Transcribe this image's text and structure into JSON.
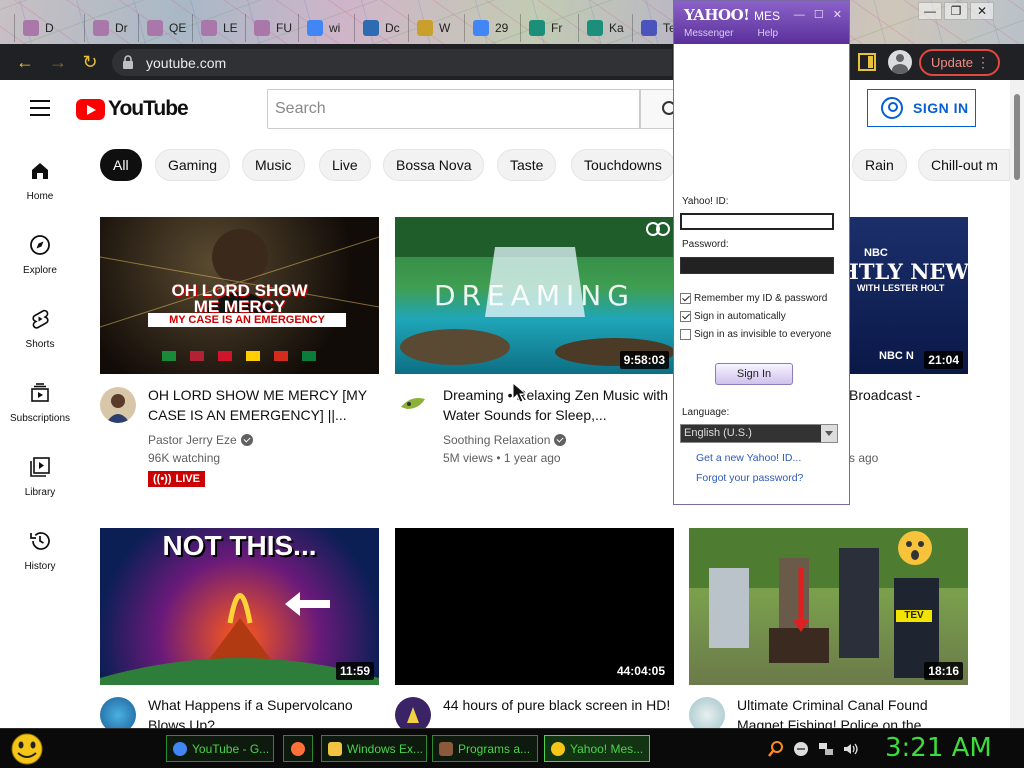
{
  "browser": {
    "tabs": [
      {
        "label": "D",
        "color": "#a7a"
      },
      {
        "label": "Dr",
        "color": "#a7a"
      },
      {
        "label": "QE",
        "color": "#a7a"
      },
      {
        "label": "LE",
        "color": "#a7a"
      },
      {
        "label": "FU",
        "color": "#a7a"
      },
      {
        "label": "wi",
        "color": "#4285f4"
      },
      {
        "label": "Dc",
        "color": "#2d6cb3"
      },
      {
        "label": "W",
        "color": "#c9a02c"
      },
      {
        "label": "29",
        "color": "#4285f4"
      },
      {
        "label": "Fr",
        "color": "#1c8f7b"
      },
      {
        "label": "Ka",
        "color": "#1c8f7b"
      },
      {
        "label": "Te",
        "color": "#4b53bc"
      }
    ],
    "window_controls": {
      "minimize": "—",
      "restore": "❐",
      "close": "✕"
    },
    "back": "←",
    "forward": "→",
    "reload": "↻",
    "url": "youtube.com",
    "update_label": "Update",
    "update_menu": "⋮"
  },
  "youtube": {
    "logo_text": "YouTube",
    "search_placeholder": "Search",
    "sign_in_label": "SIGN IN",
    "chips": [
      "All",
      "Gaming",
      "Music",
      "Live",
      "Bossa Nova",
      "Taste",
      "Touchdowns",
      "Rain",
      "Chill-out m"
    ],
    "sidebar": [
      {
        "label": "Home",
        "icon": "home-icon"
      },
      {
        "label": "Explore",
        "icon": "compass-icon"
      },
      {
        "label": "Shorts",
        "icon": "shorts-icon"
      },
      {
        "label": "Subscriptions",
        "icon": "subscriptions-icon"
      },
      {
        "label": "Library",
        "icon": "library-icon"
      },
      {
        "label": "History",
        "icon": "history-icon"
      }
    ],
    "videos": [
      {
        "title": "OH LORD SHOW ME MERCY [MY CASE IS AN EMERGENCY] ||...",
        "channel": "Pastor Jerry Eze",
        "meta": "96K watching",
        "badge": "LIVE",
        "thumb_text": [
          "OH LORD SHOW",
          "ME MERCY",
          "MY CASE IS AN EMERGENCY"
        ]
      },
      {
        "title": "Dreaming • Relaxing Zen Music with Water Sounds for Sleep,...",
        "channel": "Soothing Relaxation",
        "meta": "5M views • 1 year ago",
        "duration": "9:58:03",
        "thumb_text": [
          "DREAMING"
        ]
      },
      {
        "title": "Broadcast -",
        "meta": "s ago",
        "duration": "21:04",
        "thumb_text": [
          "NBC",
          "HTLY NEWS",
          "WITH LESTER HOLT",
          "NBC N"
        ]
      },
      {
        "title": "What Happens if a Supervolcano Blows Up?",
        "duration": "11:59",
        "thumb_text": [
          "NOT THIS..."
        ]
      },
      {
        "title": "44 hours of pure black screen in HD!",
        "duration": "44:04:05"
      },
      {
        "title": "Ultimate Criminal Canal Found Magnet Fishing! Police on the...",
        "duration": "18:16",
        "thumb_text": [
          "TEV"
        ]
      }
    ]
  },
  "yahoo": {
    "brand": "YAHOO!",
    "brand_suffix": "MES",
    "controls": "— ☐ ✕",
    "menu": [
      "Messenger",
      "Help"
    ],
    "id_label": "Yahoo! ID:",
    "password_label": "Password:",
    "remember_label": "Remember my ID & password",
    "auto_label": "Sign in automatically",
    "invisible_label": "Sign in as invisible to everyone",
    "remember_checked": true,
    "auto_checked": true,
    "invisible_checked": false,
    "sign_in_label": "Sign In",
    "language_label": "Language:",
    "language_value": "English (U.S.)",
    "new_id_link": "Get a new Yahoo! ID...",
    "forgot_link": "Forgot your password?"
  },
  "taskbar": {
    "tasks": [
      {
        "label": "YouTube - G...",
        "color": "#4285f4"
      },
      {
        "label": "",
        "color": "#ff7139"
      },
      {
        "label": "Windows Ex...",
        "color": "#f3c441"
      },
      {
        "label": "Programs a...",
        "color": "#8b5a3c"
      },
      {
        "label": "Yahoo! Mes...",
        "color": "#f5c518"
      }
    ],
    "clock": "3:21 AM"
  }
}
